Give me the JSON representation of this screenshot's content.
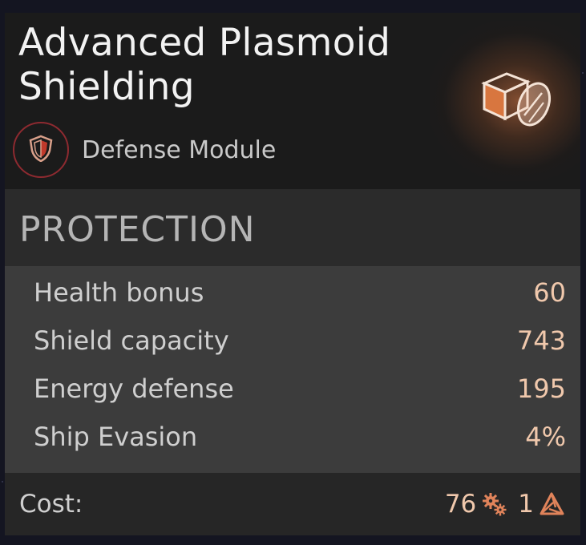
{
  "item": {
    "title": "Advanced Plasmoid Shielding",
    "category": "Defense Module",
    "icon": "shield-cube-icon",
    "category_icon": "shield-badge-icon",
    "accent": "#d8763f",
    "badge_color": "#8e2a30"
  },
  "section": {
    "title": "PROTECTION"
  },
  "stats": [
    {
      "label": "Health bonus",
      "value": "60"
    },
    {
      "label": "Shield capacity",
      "value": "743"
    },
    {
      "label": "Energy defense",
      "value": "195"
    },
    {
      "label": "Ship Evasion",
      "value": "4%"
    }
  ],
  "cost": {
    "label": "Cost:",
    "industry": "76",
    "industry_icon": "gears-icon",
    "strategic": "1",
    "strategic_icon": "triangle-resource-icon"
  }
}
